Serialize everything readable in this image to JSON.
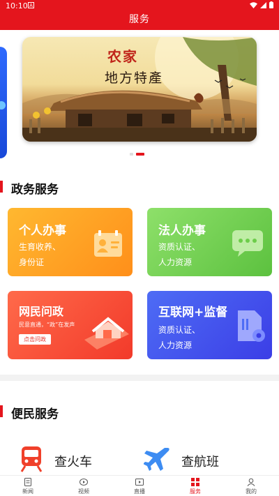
{
  "status_bar": {
    "time": "10:10",
    "badge": "A"
  },
  "header": {
    "title": "服务"
  },
  "banner": {
    "title_line1": "农家",
    "title_line2": "地方特產",
    "pages": 2,
    "active_page": 2
  },
  "sections": {
    "government": {
      "title": "政务服务"
    },
    "convenience": {
      "title": "便民服务"
    }
  },
  "gov_cards": [
    {
      "title": "个人办事",
      "line1": "生育收养、",
      "line2": "身份证",
      "icon": "id-card-icon"
    },
    {
      "title": "法人办事",
      "line1": "资质认证、",
      "line2": "人力资源",
      "icon": "chat-bubble-icon"
    },
    {
      "title": "网民问政",
      "subtitle": "民意直通，“政”在发声",
      "button": "点击问政",
      "icon": "phone-house-illustration"
    },
    {
      "title": "互联网+监督",
      "line1": "资质认证、",
      "line2": "人力资源",
      "icon": "document-gear-icon"
    }
  ],
  "convenience_items": [
    {
      "label": "查火车",
      "icon": "train-icon"
    },
    {
      "label": "查航班",
      "icon": "airplane-icon"
    }
  ],
  "bottom_nav": [
    {
      "label": "新闻",
      "icon": "news-icon",
      "active": false
    },
    {
      "label": "视频",
      "icon": "video-icon",
      "active": false
    },
    {
      "label": "直播",
      "icon": "live-icon",
      "active": false
    },
    {
      "label": "服务",
      "icon": "service-grid-icon",
      "active": true
    },
    {
      "label": "我的",
      "icon": "profile-icon",
      "active": false
    }
  ],
  "colors": {
    "brand_red": "#e4151d",
    "card_orange": "#ff9f22",
    "card_green": "#6ccd4a",
    "card_red": "#f2442e",
    "card_blue": "#4450ec"
  }
}
